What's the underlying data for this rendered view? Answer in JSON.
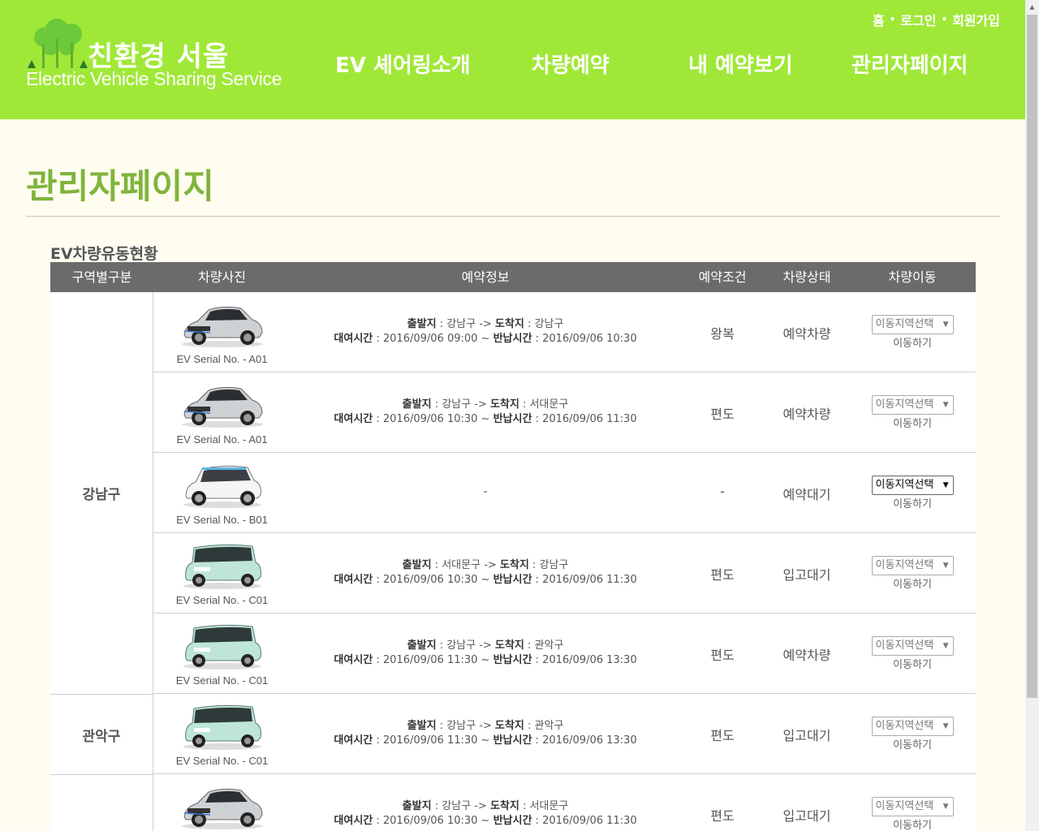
{
  "logo": {
    "title_kr": "친환경 서울",
    "title_en": "Electric Vehicle Sharing Service"
  },
  "util_nav": {
    "home": "홈",
    "login": "로그인",
    "signup": "회원가입",
    "separator": "•"
  },
  "nav": {
    "intro": "EV 셰어링소개",
    "reserve": "차량예약",
    "my_reservation": "내 예약보기",
    "admin": "관리자페이지"
  },
  "page_title": "관리자페이지",
  "section_title": "EV차량유동현황",
  "table_headers": {
    "region": "구역별구분",
    "photo": "차량사진",
    "info": "예약정보",
    "condition": "예약조건",
    "state": "차량상태",
    "move": "차량이동"
  },
  "labels": {
    "from": "출발지",
    "to": "도착지",
    "rent_time": "대여시간",
    "return_time": "반납시간",
    "select_placeholder": "이동지역선택",
    "move_button": "이동하기"
  },
  "regions": [
    "강남구",
    "관악구"
  ],
  "rows": [
    {
      "serial": "EV Serial No. - A01",
      "car": "bmw",
      "from": "강남구",
      "to": "강남구",
      "rent": "2016/09/06 09:00",
      "ret": "2016/09/06 10:30",
      "cond": "왕복",
      "state": "예약차량"
    },
    {
      "serial": "EV Serial No. - A01",
      "car": "bmw",
      "from": "강남구",
      "to": "서대문구",
      "rent": "2016/09/06 10:30",
      "ret": "2016/09/06 11:30",
      "cond": "편도",
      "state": "예약차량"
    },
    {
      "serial": "EV Serial No. - B01",
      "car": "soul",
      "dash": "-",
      "cond": "-",
      "state": "예약대기"
    },
    {
      "serial": "EV Serial No. - C01",
      "car": "ray",
      "from": "서대문구",
      "to": "강남구",
      "rent": "2016/09/06 10:30",
      "ret": "2016/09/06 11:30",
      "cond": "편도",
      "state": "입고대기"
    },
    {
      "serial": "EV Serial No. - C01",
      "car": "ray",
      "from": "강남구",
      "to": "관악구",
      "rent": "2016/09/06 11:30",
      "ret": "2016/09/06 13:30",
      "cond": "편도",
      "state": "예약차량"
    },
    {
      "serial": "EV Serial No. - C01",
      "car": "ray",
      "from": "강남구",
      "to": "관악구",
      "rent": "2016/09/06 11:30",
      "ret": "2016/09/06 13:30",
      "cond": "편도",
      "state": "입고대기"
    },
    {
      "car": "bmw",
      "from": "강남구",
      "to": "서대문구",
      "rent": "2016/09/06 10:30",
      "ret": "2016/09/06 11:30",
      "cond": "편도",
      "state": "입고대기"
    }
  ],
  "colors": {
    "header_bg": "#a0e838",
    "title_green": "#80b43c",
    "page_bg": "#fffdf0",
    "table_head_bg": "#6b6b6b"
  }
}
